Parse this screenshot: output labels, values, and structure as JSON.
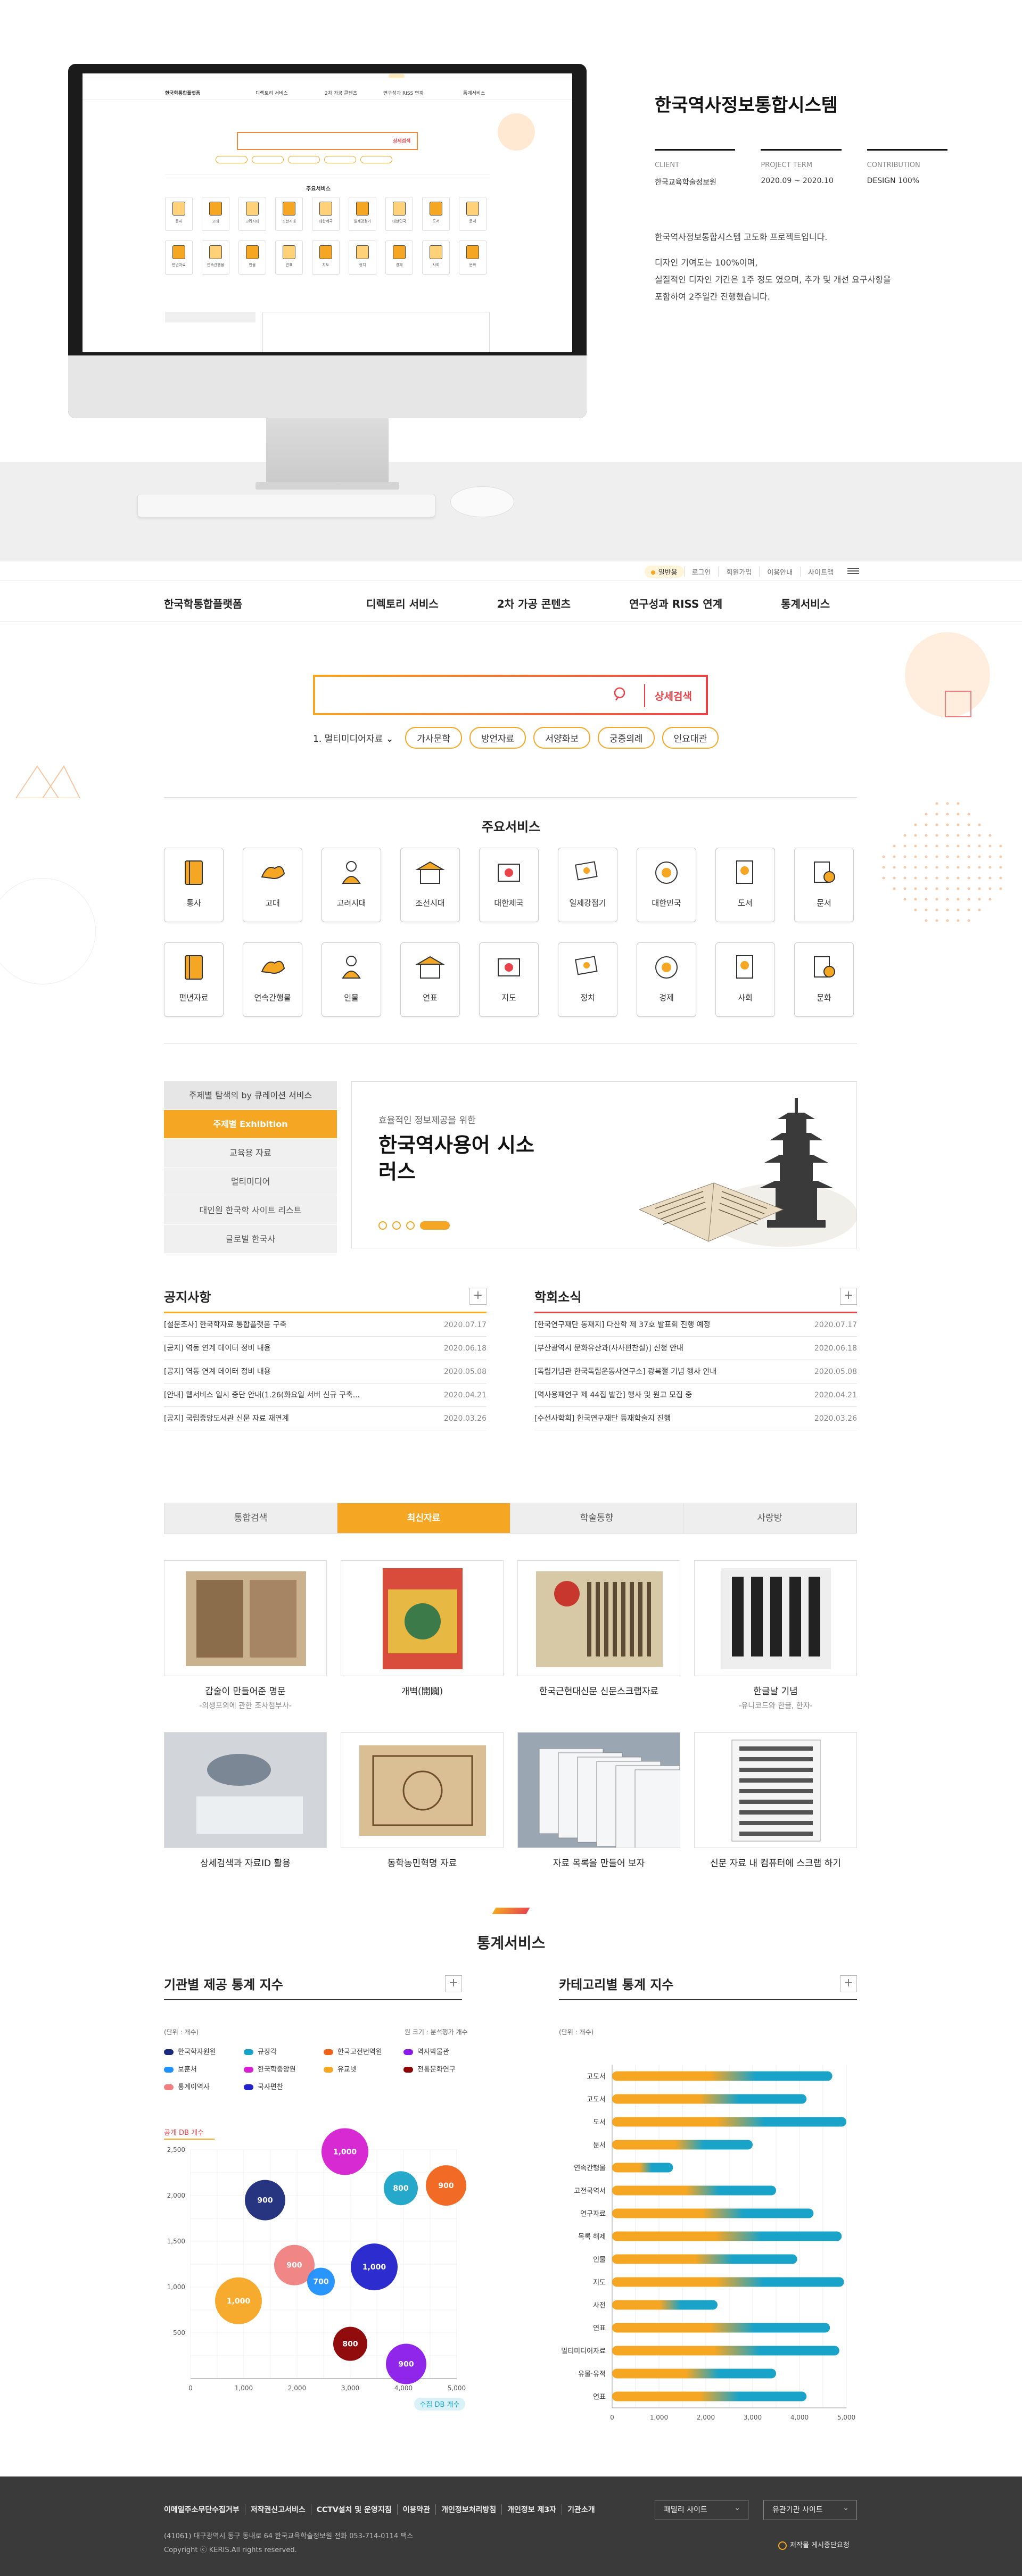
{
  "project": {
    "title": "한국역사정보통합시스템",
    "meta": [
      {
        "key": "CLIENT",
        "value": "한국교육학술정보원"
      },
      {
        "key": "PROJECT TERM",
        "value": "2020.09 ~ 2020.10"
      },
      {
        "key": "CONTRIBUTION",
        "value": "DESIGN 100%"
      }
    ],
    "desc": [
      "한국역사정보통합시스템 고도화 프로젝트입니다.",
      "디자인 기여도는 100%이며,",
      "실질적인 디자인 기간은 1주 정도 였으며, 추가 및 개선 요구사항을",
      "포함하여 2주일간 진행했습니다."
    ]
  },
  "topbar": {
    "lang": "일반용",
    "links": [
      "로그인",
      "회원가입",
      "이용안내",
      "사이트맵"
    ]
  },
  "gnb": {
    "logo": "한국학통합플랫폼",
    "menu": [
      "디렉토리 서비스",
      "2차 가공 콘텐츠",
      "연구성과 RISS 연계",
      "통계서비스"
    ]
  },
  "search": {
    "placeholder": "",
    "button": "상세검색",
    "lead": "1. 멀티미디어자료",
    "keywords": [
      "가사문학",
      "방언자료",
      "서양화보",
      "궁중의례",
      "인요대관"
    ]
  },
  "services": {
    "title": "주요서비스",
    "items": [
      "통사",
      "고대",
      "고려시대",
      "조선시대",
      "대한제국",
      "일제강점기",
      "대한민국",
      "도서",
      "문서",
      "편년자료",
      "연속간행물",
      "인물",
      "연표",
      "지도",
      "정치",
      "경제",
      "사회",
      "문화"
    ]
  },
  "curation": {
    "items": [
      "주제별 탐색의 by 큐레이션 서비스",
      "주제별 Exhibition",
      "교육용 자료",
      "멀티미디어",
      "대인원 한국학 사이트 리스트",
      "글로벌 한국사"
    ]
  },
  "banner": {
    "sub": "효율적인 정보제공을 위한",
    "title": "한국역사용어 시소러스"
  },
  "notice": {
    "title": "공지사항",
    "rows": [
      {
        "t": "[설문조사] 한국학자료 통합플랫폼 구축",
        "d": "2020.07.17"
      },
      {
        "t": "[공지] 역동 연계 데이터 정비 내용",
        "d": "2020.06.18"
      },
      {
        "t": "[공지] 역동 연계 데이터 정비 내용",
        "d": "2020.05.08"
      },
      {
        "t": "[안내] 웹서비스 일시 중단 안내(1.26(화요일 서버 신규 구축...",
        "d": "2020.04.21"
      },
      {
        "t": "[공지] 국립중앙도서관 신문 자료 재연계",
        "d": "2020.03.26"
      }
    ]
  },
  "academic": {
    "title": "학회소식",
    "rows": [
      {
        "t": "[한국연구재단 동재지] 다산학 제 37호 발표회 진행 예정",
        "d": "2020.07.17"
      },
      {
        "t": "[부산광역시 문화유산과(사사편찬실)] 신청 안내",
        "d": "2020.06.18"
      },
      {
        "t": "[독립기념관 한국독립운동사연구소] 광복절 기념 행사 안내",
        "d": "2020.05.08"
      },
      {
        "t": "[역사용재연구 제 44집 발간] 행사 및 원고 모집 중",
        "d": "2020.04.21"
      },
      {
        "t": "[수선사학회] 한국연구재단 등재학술지 진행",
        "d": "2020.03.26"
      }
    ]
  },
  "tabs": [
    "통합검색",
    "최신자료",
    "학술동향",
    "사랑방"
  ],
  "cards_row1": [
    {
      "t": "갑술이 만들어준 명문",
      "s": "-의생포외에 관한 조사첨부사-"
    },
    {
      "t": "개벽(開闢)",
      "s": ""
    },
    {
      "t": "한국근현대신문 신문스크랩자료",
      "s": ""
    },
    {
      "t": "한글날 기념",
      "s": "-유니코드와 한글, 한자-"
    }
  ],
  "cards_row2": [
    {
      "t": "상세검색과 자료ID 활용",
      "s": ""
    },
    {
      "t": "동학농민혁명 자료",
      "s": ""
    },
    {
      "t": "자료 목록을 만들어 보자",
      "s": ""
    },
    {
      "t": "신문 자료 내 컴퓨터에 스크랩 하기",
      "s": ""
    }
  ],
  "stats": {
    "title": "통계서비스",
    "left_title": "기관별 제공 통계 지수",
    "left_unit": "(단위 : 개수)",
    "left_note": "원 크기 : 분석행가 개수",
    "left_legend": [
      "한국학자원원",
      "규장각",
      "한국고전번역원",
      "역사박물관",
      "보훈처",
      "한국학중앙원",
      "유교넷",
      "전통문화연구",
      "통계이역사",
      "국사편찬"
    ],
    "right_title": "카테고리별 통계 지수",
    "right_unit": "(단위 : 개수)"
  },
  "chart_data": [
    {
      "type": "scatter",
      "title": "기관별 제공 통계 지수",
      "xlabel": "수집 DB 개수",
      "ylabel": "공개 DB 개수",
      "xlim": [
        0,
        5000
      ],
      "ylim": [
        0,
        2500
      ],
      "xticks": [
        "0",
        "1,000",
        "2,000",
        "3,000",
        "4,000",
        "5,000"
      ],
      "yticks": [
        "500",
        "1,000",
        "1,500",
        "2,000",
        "2,500"
      ],
      "points": [
        {
          "x": 900,
          "y": 850,
          "label": "1,000",
          "color": "#f5a623"
        },
        {
          "x": 1400,
          "y": 1950,
          "label": "900",
          "color": "#1b2a7a"
        },
        {
          "x": 1950,
          "y": 1240,
          "label": "900",
          "color": "#f08080"
        },
        {
          "x": 2450,
          "y": 1060,
          "label": "700",
          "color": "#1e90ff"
        },
        {
          "x": 2900,
          "y": 2480,
          "label": "1,000",
          "color": "#d61fd0"
        },
        {
          "x": 3450,
          "y": 1220,
          "label": "1,000",
          "color": "#2222cc"
        },
        {
          "x": 3000,
          "y": 380,
          "label": "800",
          "color": "#8b0000"
        },
        {
          "x": 3950,
          "y": 2080,
          "label": "800",
          "color": "#1aa3c8"
        },
        {
          "x": 4800,
          "y": 2110,
          "label": "900",
          "color": "#f0631a"
        },
        {
          "x": 4050,
          "y": 160,
          "label": "900",
          "color": "#8a1ae8"
        }
      ]
    },
    {
      "type": "bar",
      "title": "카테고리별 통계 지수",
      "categories": [
        "고도서",
        "고도서",
        "도서",
        "문서",
        "연속간행물",
        "고전국역서",
        "연구자료",
        "목록 해제",
        "인물",
        "지도",
        "사전",
        "연표",
        "멀티미디어자료",
        "유물·유적",
        "연표"
      ],
      "series": [
        {
          "name": "공개 DB 개수",
          "color": "#f5a623",
          "values": [
            2300,
            2200,
            2600,
            1500,
            500,
            1700,
            2000,
            2500,
            1900,
            2700,
            1100,
            2400,
            2300,
            1800,
            2100
          ]
        },
        {
          "name": "수집 DB 개수",
          "color": "#1aa3c8",
          "values": [
            4700,
            4150,
            5000,
            3000,
            1300,
            3500,
            4300,
            4900,
            3950,
            4950,
            2250,
            4650,
            4850,
            3500,
            4150
          ]
        }
      ],
      "xlim": [
        0,
        5000
      ],
      "xticks": [
        "0",
        "1,000",
        "2,000",
        "3,000",
        "4,000",
        "5,000"
      ]
    }
  ],
  "footer": {
    "links": [
      "이메일주소무단수집거부",
      "저작권신고서비스",
      "CCTV설치 및 운영지침",
      "이용약관",
      "개인정보처리방침",
      "개인정보 제3자",
      "기관소개"
    ],
    "address": "(41061) 대구광역시 동구 동내로 64 한국교육학술정보원 전화 053-714-0114 팩스",
    "copyright": "Copyright ⓒ KERIS.All rights reserved.",
    "select1": "패밀리 사이트",
    "select2": "유관기관 사이트",
    "mark": "저작물 게시중단요청"
  }
}
